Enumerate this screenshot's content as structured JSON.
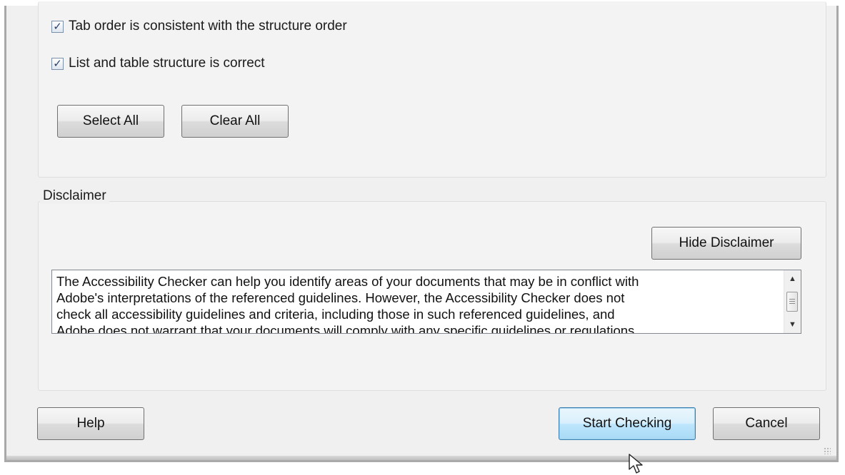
{
  "options": {
    "checkboxes": [
      {
        "label": "Tab order is consistent with the structure order",
        "checked": true
      },
      {
        "label": "List and table structure is correct",
        "checked": true
      }
    ],
    "select_all_label": "Select All",
    "clear_all_label": "Clear All"
  },
  "disclaimer": {
    "legend": "Disclaimer",
    "hide_button_label": "Hide Disclaimer",
    "text": "The Accessibility Checker can help you identify areas of your documents that may be in conflict with\nAdobe's interpretations of the referenced guidelines. However, the Accessibility Checker does not\ncheck all accessibility guidelines and criteria, including those in such referenced guidelines, and\nAdobe does not warrant that your documents will comply with any specific guidelines or regulations."
  },
  "footer": {
    "help_label": "Help",
    "start_checking_label": "Start Checking",
    "cancel_label": "Cancel"
  },
  "colors": {
    "focused_button_border": "#3c7fb1",
    "dialog_background": "#f0f0f0"
  },
  "icons": {
    "checkmark": "check-icon",
    "scroll_up": "scroll-up-arrow-icon",
    "scroll_down": "scroll-down-arrow-icon",
    "cursor": "mouse-pointer-icon"
  }
}
